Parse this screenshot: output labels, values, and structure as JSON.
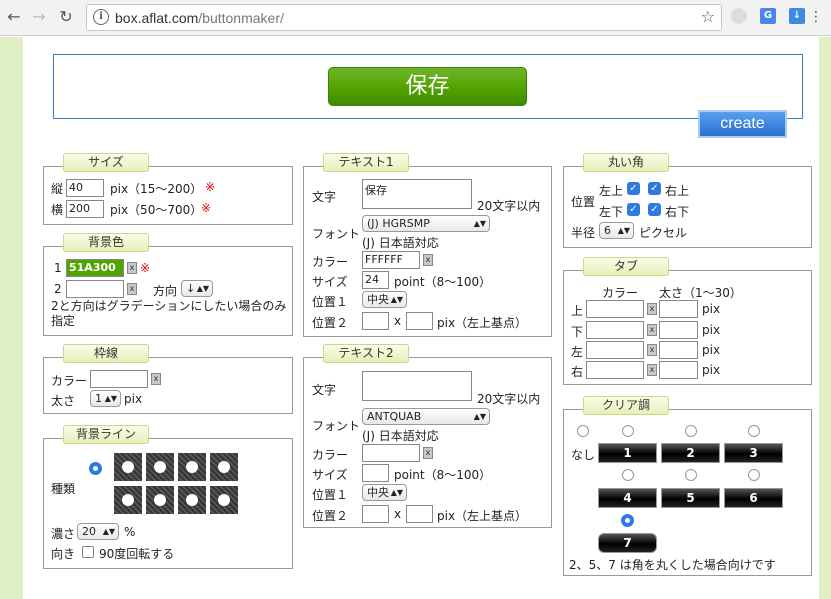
{
  "browser": {
    "url_host": "box.aflat.com",
    "url_path": "/buttonmaker/"
  },
  "preview": {
    "button_text": "保存",
    "button_color": "#51A300",
    "create_label": "create"
  },
  "size": {
    "title": "サイズ",
    "height_label": "縦",
    "height_value": "40",
    "height_hint": "pix（15〜200）",
    "width_label": "横",
    "width_value": "200",
    "width_hint": "pix（50〜700）",
    "req": "※"
  },
  "bgcolor": {
    "title": "背景色",
    "label1": "1",
    "value1": "51A300",
    "label2": "2",
    "value2": "",
    "direction_label": "方向",
    "direction_value": "↓",
    "note": "2と方向はグラデーションにしたい場合のみ指定"
  },
  "border": {
    "title": "枠線",
    "color_label": "カラー",
    "color_value": "",
    "width_label": "太さ",
    "width_value": "1",
    "unit": "pix"
  },
  "bgline": {
    "title": "背景ライン",
    "type_label": "種類",
    "density_label": "濃さ",
    "density_value": "20",
    "density_unit": "%",
    "orient_label": "向き",
    "rotate_label": "90度回転する"
  },
  "text1": {
    "title": "テキスト1",
    "text_label": "文字",
    "text_value": "保存",
    "text_hint": "20文字以内",
    "font_label": "フォント",
    "font_value": "(J) HGRSMP",
    "font_note": "(J) 日本語対応",
    "color_label": "カラー",
    "color_value": "FFFFFF",
    "size_label": "サイズ",
    "size_value": "24",
    "size_hint": "point（8〜100）",
    "pos1_label": "位置１",
    "pos1_value": "中央",
    "pos2_label": "位置２",
    "pos2_x": "",
    "pos2_sep": "x",
    "pos2_y": "",
    "pos2_hint": "pix（左上基点）"
  },
  "text2": {
    "title": "テキスト2",
    "text_label": "文字",
    "text_value": "",
    "text_hint": "20文字以内",
    "font_label": "フォント",
    "font_value": "ANTQUAB",
    "font_note": "(J) 日本語対応",
    "color_label": "カラー",
    "color_value": "",
    "size_label": "サイズ",
    "size_value": "",
    "size_hint": "point（8〜100）",
    "pos1_label": "位置１",
    "pos1_value": "中央",
    "pos2_label": "位置２",
    "pos2_x": "",
    "pos2_sep": "x",
    "pos2_y": "",
    "pos2_hint": "pix（左上基点）"
  },
  "corner": {
    "title": "丸い角",
    "pos_label": "位置",
    "top_left": "左上",
    "top_right": "右上",
    "bottom_left": "左下",
    "bottom_right": "右下",
    "radius_label": "半径",
    "radius_value": "6",
    "radius_unit": "ピクセル"
  },
  "tab": {
    "title": "タブ",
    "color_header": "カラー",
    "size_header": "太さ（1〜30）",
    "rows": [
      "上",
      "下",
      "左",
      "右"
    ],
    "unit": "pix"
  },
  "clear": {
    "title": "クリア調",
    "none_label": "なし",
    "options": [
      "1",
      "2",
      "3",
      "4",
      "5",
      "6",
      "7"
    ],
    "note": "2、5、7 は角を丸くした場合向けです"
  }
}
